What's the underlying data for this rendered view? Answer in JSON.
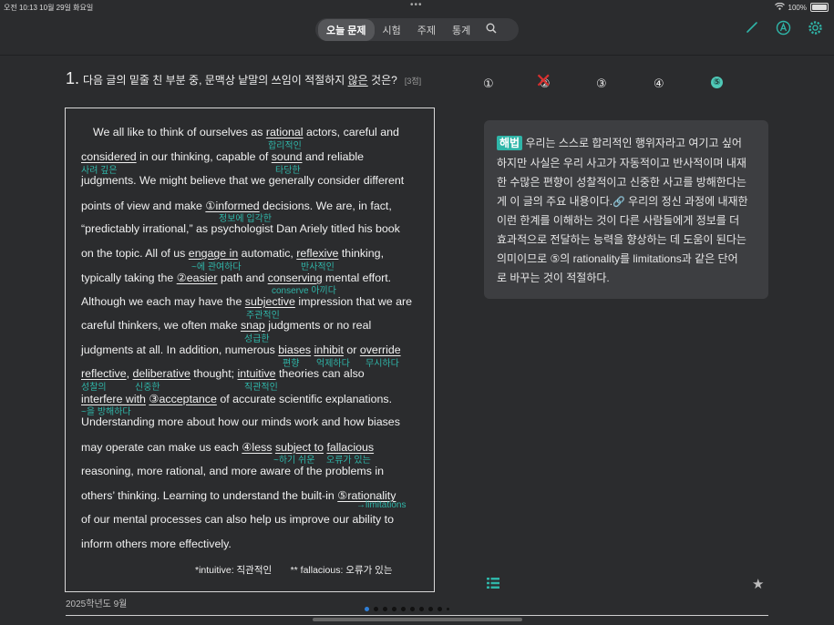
{
  "status": {
    "time_date": "오전 10:13  10월 29일 화요일",
    "battery": "100%"
  },
  "tabs": {
    "items": [
      "오늘 문제",
      "시험",
      "주제",
      "통계"
    ]
  },
  "question": {
    "number": "1.",
    "text_before": "다음 글의 밑줄 친 부분 중, 문맥상 낱말의 쓰임이 적절하지 ",
    "text_underlined": "않은",
    "text_after": " 것은?",
    "points": "[3점]"
  },
  "choices": [
    "①",
    "②",
    "③",
    "④",
    "⑤"
  ],
  "passage": {
    "l1a": "We all like to think of ourselves as ",
    "l1b": "rational",
    "l1c": " actors, careful and",
    "l2a": "considered",
    "l2b": " in our thinking, capable of ",
    "l2c": "sound",
    "l2d": " and reliable",
    "l3": "judgments. We might believe that we generally consider different",
    "l4a": "points of view and make ",
    "l4b": "①informed",
    "l4c": " decisions. We are, in fact,",
    "l5": "“predictably irrational,” as psychologist Dan Ariely titled his book",
    "l6a": "on the topic. All of us ",
    "l6b": "engage in",
    "l6c": " automatic, ",
    "l6d": "reflexive",
    "l6e": " thinking,",
    "l7a": "typically taking the ",
    "l7b": "②easier",
    "l7c": " path and ",
    "l7d": "conserving",
    "l7e": " mental effort.",
    "l8a": "Although we each may have the ",
    "l8b": "subjective",
    "l8c": " impression that we are",
    "l9a": "careful thinkers, we often make ",
    "l9b": "snap",
    "l9c": " judgments or no real",
    "l10a": "judgments at all. In addition, numerous ",
    "l10b": "biases",
    "l10c": " ",
    "l10d": "inhibit",
    "l10e": " or ",
    "l10f": "override",
    "l11a": "reflective",
    "l11b": ", ",
    "l11c": "deliberative",
    "l11d": " thought; ",
    "l11e": "intuitive",
    "l11f": " theories can also",
    "l12a": "interfere with",
    "l12b": " ",
    "l12c": "③acceptance",
    "l12d": " of accurate scientific explanations.",
    "l13": "Understanding more about how our minds work and how biases",
    "l14a": "may operate can make us each ",
    "l14b": "④less",
    "l14c": " ",
    "l14d": "subject to",
    "l14e": " ",
    "l14f": "fallacious",
    "l15": "reasoning, more rational, and more aware of the problems in",
    "l16a": "others’ thinking. Learning to understand the built-in ",
    "l16b": "⑤rationality",
    "l17": "of our mental processes can also help us improve our ability to",
    "l18": "inform others more effectively.",
    "footnote": "*intuitive: 직관적인       ** fallacious: 오류가 있는"
  },
  "gloss": {
    "rational": "합리적인",
    "considered": "사려 깊은",
    "sound": "타당한",
    "informed": "정보에 입각한",
    "engage_in": "~에 관여하다",
    "reflexive": "반사적인",
    "conserving": "conserve 아끼다",
    "subjective": "주관적인",
    "snap": "성급한",
    "biases": "편향",
    "inhibit": "억제하다",
    "override": "무시하다",
    "reflective": "성찰의",
    "deliberative": "신중한",
    "intuitive": "직관적인",
    "interfere_with": "~을 방해하다",
    "subject_to": "~하기 쉬운",
    "fallacious": "오류가 있는",
    "rationality": "→limitations"
  },
  "explanation": {
    "badge": "해법",
    "lines": [
      "우리는 스스로 합리적인 행위자라고 여기고 싶어",
      "하지만 사실은 우리 사고가 자동적이고 반사적이며 내재",
      "한 수많은 편향이 성찰적이고 신중한 사고를 방해한다는",
      "게 이 글의 주요 내용이다.",
      "우리의 정신 과정에 내재한",
      "이런 한계를 이해하는 것이 다른 사람들에게 정보를 더",
      "효과적으로 전달하는 능력을 향상하는 데 도움이 된다는",
      "의미이므로 ⑤의 rationality를 limitations과 같은 단어",
      "로 바꾸는 것이 적절하다."
    ]
  },
  "footer": {
    "year": "2025학년도 9월"
  },
  "colors": {
    "accent": "#2fb5a8",
    "wrong_mark": "#d9302f",
    "background": "#2b2c2e"
  }
}
